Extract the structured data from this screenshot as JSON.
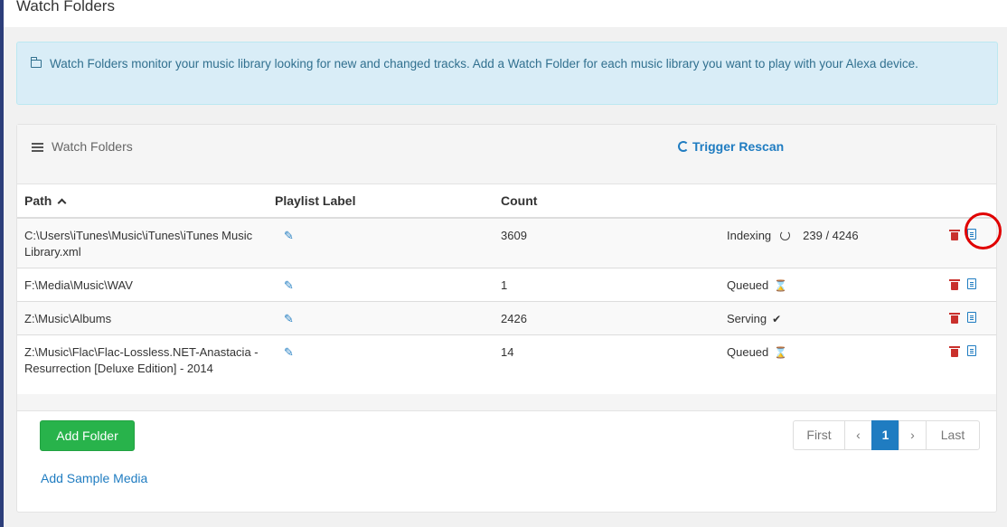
{
  "header": {
    "title": "Watch Folders"
  },
  "info": {
    "text": "Watch Folders monitor your music library looking for new and changed tracks. Add a Watch Folder for each music library you want to play with your Alexa device."
  },
  "panel": {
    "title": "Watch Folders",
    "rescan_label": "Trigger Rescan"
  },
  "table": {
    "columns": [
      "Path",
      "Playlist Label",
      "Count"
    ],
    "rows": [
      {
        "path": "C:\\Users\\iTunes\\Music\\iTunes\\iTunes Music Library.xml",
        "count": "3609",
        "status": "Indexing",
        "status_icon": "spinner-icon",
        "progress": "239 / 4246"
      },
      {
        "path": "F:\\Media\\Music\\WAV",
        "count": "1",
        "status": "Queued",
        "status_icon": "hourglass-icon",
        "progress": ""
      },
      {
        "path": "Z:\\Music\\Albums",
        "count": "2426",
        "status": "Serving",
        "status_icon": "check-icon",
        "progress": ""
      },
      {
        "path": "Z:\\Music\\Flac\\Flac-Lossless.NET-Anastacia - Resurrection [Deluxe Edition] - 2014",
        "count": "14",
        "status": "Queued",
        "status_icon": "hourglass-icon",
        "progress": ""
      }
    ]
  },
  "footer": {
    "add_folder_label": "Add Folder",
    "add_sample_label": "Add Sample Media"
  },
  "pagination": {
    "first": "First",
    "prev": "‹",
    "current": "1",
    "next": "›",
    "last": "Last"
  },
  "colors": {
    "accent": "#1f7cc1",
    "success": "#28b34b",
    "danger": "#c9302c",
    "info_bg": "#d9edf7",
    "highlight": "#e00000"
  }
}
